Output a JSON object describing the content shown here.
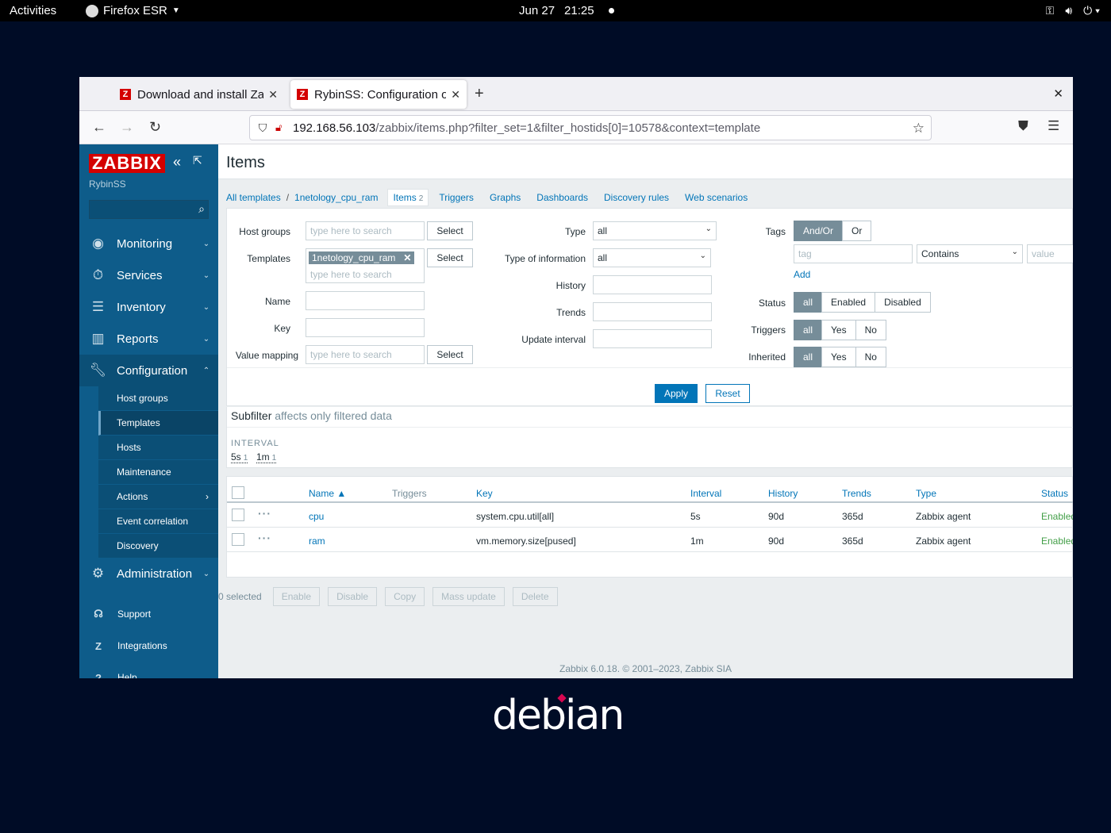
{
  "topbar": {
    "activities": "Activities",
    "app": "Firefox ESR",
    "date": "Jun 27",
    "time": "21:25"
  },
  "browser": {
    "tabs": [
      {
        "title": "Download and install Zabbix",
        "active": false
      },
      {
        "title": "RybinSS: Configuration of items",
        "active": true
      }
    ],
    "url_host": "192.168.56.103",
    "url_path": "/zabbix/items.php?filter_set=1&filter_hostids[0]=10578&context=template"
  },
  "sidebar": {
    "brand": "ZABBIX",
    "server": "RybinSS",
    "menu": [
      {
        "label": "Monitoring",
        "icon": "eye-icon"
      },
      {
        "label": "Services",
        "icon": "stopwatch-icon"
      },
      {
        "label": "Inventory",
        "icon": "list-icon"
      },
      {
        "label": "Reports",
        "icon": "bar-chart-icon"
      },
      {
        "label": "Configuration",
        "icon": "wrench-icon"
      },
      {
        "label": "Administration",
        "icon": "gear-icon"
      }
    ],
    "submenu": [
      "Host groups",
      "Templates",
      "Hosts",
      "Maintenance",
      "Actions",
      "Event correlation",
      "Discovery"
    ],
    "bottom": [
      "Support",
      "Integrations",
      "Help"
    ]
  },
  "page": {
    "title": "Items",
    "breadcrumbs": {
      "all": "All templates",
      "template": "1netology_cpu_ram",
      "current": "Items",
      "current_count": "2",
      "links": [
        "Triggers",
        "Graphs",
        "Dashboards",
        "Discovery rules",
        "Web scenarios"
      ]
    }
  },
  "filter": {
    "host_groups_label": "Host groups",
    "templates_label": "Templates",
    "name_label": "Name",
    "key_label": "Key",
    "value_mapping_label": "Value mapping",
    "placeholder": "type here to search",
    "select": "Select",
    "template_chip": "1netology_cpu_ram",
    "type_label": "Type",
    "type_value": "all",
    "type_info_label": "Type of information",
    "type_info_value": "all",
    "history_label": "History",
    "trends_label": "Trends",
    "update_interval_label": "Update interval",
    "tags_label": "Tags",
    "tags_options": [
      "And/Or",
      "Or"
    ],
    "tag_placeholder": "tag",
    "tag_operator": "Contains",
    "value_placeholder": "value",
    "add": "Add",
    "status_label": "Status",
    "status_options": [
      "all",
      "Enabled",
      "Disabled"
    ],
    "triggers_label": "Triggers",
    "inherited_label": "Inherited",
    "yn_options": [
      "all",
      "Yes",
      "No"
    ],
    "apply": "Apply",
    "reset": "Reset"
  },
  "subfilter": {
    "title": "Subfilter",
    "hint": "affects only filtered data",
    "interval_header": "INTERVAL",
    "values": [
      {
        "label": "5s",
        "count": "1"
      },
      {
        "label": "1m",
        "count": "1"
      }
    ]
  },
  "table": {
    "columns": [
      "Name ▲",
      "Triggers",
      "Key",
      "Interval",
      "History",
      "Trends",
      "Type",
      "Status"
    ],
    "rows": [
      {
        "name": "cpu",
        "key": "system.cpu.util[all]",
        "interval": "5s",
        "history": "90d",
        "trends": "365d",
        "type": "Zabbix agent",
        "status": "Enabled"
      },
      {
        "name": "ram",
        "key": "vm.memory.size[pused]",
        "interval": "1m",
        "history": "90d",
        "trends": "365d",
        "type": "Zabbix agent",
        "status": "Enabled"
      }
    ]
  },
  "actions": {
    "selected": "0 selected",
    "buttons": [
      "Enable",
      "Disable",
      "Copy",
      "Mass update",
      "Delete"
    ]
  },
  "footer": "Zabbix 6.0.18. © 2001–2023, Zabbix SIA",
  "desktop": {
    "logo": "debian"
  }
}
